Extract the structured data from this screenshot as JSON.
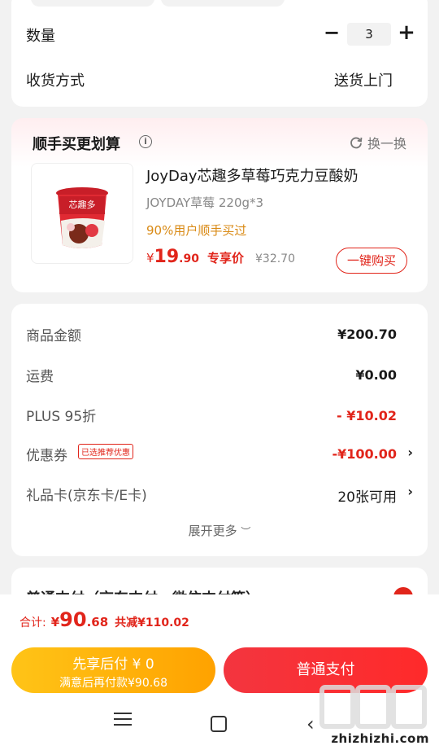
{
  "order": {
    "quantity_label": "数量",
    "quantity_value": "3",
    "minus_symbol": "−",
    "plus_symbol": "+",
    "shipping_label": "收货方式",
    "shipping_value": "送货上门"
  },
  "addon": {
    "title": "顺手买更划算",
    "info_symbol": "i",
    "swap_label": "换一换",
    "product": {
      "title": "JoyDay芯趣多草莓巧克力豆酸奶",
      "spec": "JOYDAY草莓 220g*3",
      "hint": "90%用户顺手买过",
      "price_symbol": "¥",
      "price_int": "19",
      "price_dec": ".90",
      "price_tag": "专享价",
      "original_price": "¥32.70",
      "buy_label": "一键购买",
      "cup_brand": "芯趣多"
    }
  },
  "summary": {
    "goods_label": "商品金额",
    "goods_value": "¥200.70",
    "freight_label": "运费",
    "freight_value": "¥0.00",
    "plus_label": "PLUS 95折",
    "plus_value": "- ¥10.02",
    "coupon_label": "优惠券",
    "coupon_tag": "已选推荐优惠",
    "coupon_value": "-¥100.00",
    "giftcard_label": "礼品卡(京东卡/E卡)",
    "giftcard_value": "20张可用",
    "expand_label": "展开更多"
  },
  "payment_peek": {
    "label": "普通支付（京东支付、微信支付等）"
  },
  "bottom": {
    "total_label": "合计:",
    "total_symbol": "¥",
    "total_int": "90",
    "total_dec": ".68",
    "total_save": "共减¥110.02",
    "later_line1": "先享后付 ¥ 0",
    "later_line2": "满意后再付款¥90.68",
    "pay_label": "普通支付",
    "watermark": "zhizhizhi.com"
  },
  "colors": {
    "accent_red": "#e1251b",
    "hint_orange": "#d98a15",
    "later_yellow": "#ffb100"
  },
  "icons": {
    "info": "info-icon",
    "swap": "refresh-icon",
    "chevron": "chevron-right-icon",
    "expand": "chevron-down-icon",
    "nav_menu": "menu-icon",
    "nav_home": "home-icon",
    "nav_back": "back-icon"
  }
}
